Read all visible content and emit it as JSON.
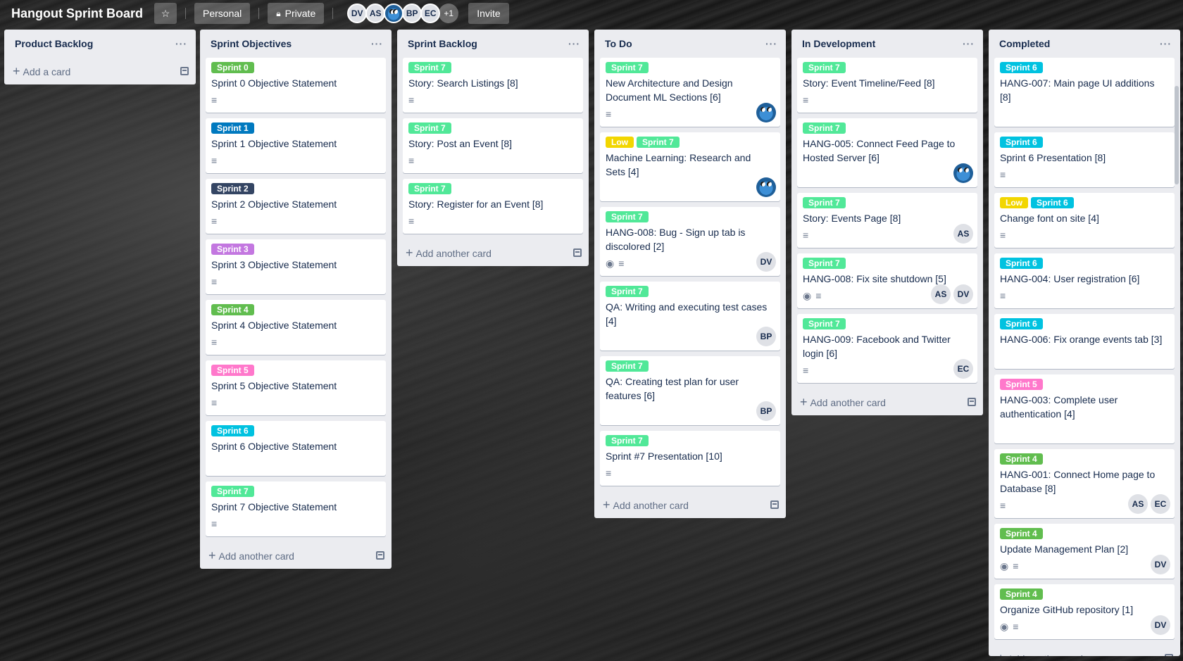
{
  "header": {
    "title": "Hangout Sprint Board",
    "personal_label": "Personal",
    "private_label": "Private",
    "members": [
      "DV",
      "AS",
      "",
      "BP",
      "EC"
    ],
    "more_members": "+1",
    "invite_label": "Invite"
  },
  "label_colors": {
    "Sprint 0": "#61bd4f",
    "Sprint 1": "#0079bf",
    "Sprint 2": "#344563",
    "Sprint 3": "#c377e0",
    "Sprint 4": "#61bd4f",
    "Sprint 5": "#ff78cb",
    "Sprint 6": "#00c2e0",
    "Sprint 7": "#51e898",
    "Low": "#f2d600"
  },
  "lists": [
    {
      "title": "Product Backlog",
      "cards": [],
      "add_label": "Add a card"
    },
    {
      "title": "Sprint Objectives",
      "add_label": "Add another card",
      "cards": [
        {
          "labels": [
            "Sprint 0"
          ],
          "title": "Sprint 0 Objective Statement",
          "desc": true
        },
        {
          "labels": [
            "Sprint 1"
          ],
          "title": "Sprint 1 Objective Statement",
          "desc": true
        },
        {
          "labels": [
            "Sprint 2"
          ],
          "title": "Sprint 2 Objective Statement",
          "desc": true
        },
        {
          "labels": [
            "Sprint 3"
          ],
          "title": "Sprint 3 Objective Statement",
          "desc": true
        },
        {
          "labels": [
            "Sprint 4"
          ],
          "title": "Sprint 4 Objective Statement",
          "desc": true
        },
        {
          "labels": [
            "Sprint 5"
          ],
          "title": "Sprint 5 Objective Statement",
          "desc": true
        },
        {
          "labels": [
            "Sprint 6"
          ],
          "title": "Sprint 6 Objective Statement",
          "desc": false
        },
        {
          "labels": [
            "Sprint 7"
          ],
          "title": "Sprint 7 Objective Statement",
          "desc": true
        }
      ]
    },
    {
      "title": "Sprint Backlog",
      "add_label": "Add another card",
      "cards": [
        {
          "labels": [
            "Sprint 7"
          ],
          "title": "Story: Search Listings [8]",
          "desc": true
        },
        {
          "labels": [
            "Sprint 7"
          ],
          "title": "Story: Post an Event [8]",
          "desc": true
        },
        {
          "labels": [
            "Sprint 7"
          ],
          "title": "Story: Register for an Event [8]",
          "desc": true
        }
      ]
    },
    {
      "title": "To Do",
      "add_label": "Add another card",
      "cards": [
        {
          "labels": [
            "Sprint 7"
          ],
          "title": "New Architecture and Design Document ML Sections [6]",
          "desc": true,
          "members": [
            ""
          ]
        },
        {
          "labels": [
            "Low",
            "Sprint 7"
          ],
          "title": "Machine Learning: Research and Sets [4]",
          "desc": false,
          "members": [
            ""
          ]
        },
        {
          "labels": [
            "Sprint 7"
          ],
          "title": "HANG-008: Bug - Sign up tab is discolored [2]",
          "watch": true,
          "desc": true,
          "members": [
            "DV"
          ]
        },
        {
          "labels": [
            "Sprint 7"
          ],
          "title": "QA: Writing and executing test cases [4]",
          "desc": false,
          "members": [
            "BP"
          ]
        },
        {
          "labels": [
            "Sprint 7"
          ],
          "title": "QA: Creating test plan for user features [6]",
          "desc": false,
          "members": [
            "BP"
          ]
        },
        {
          "labels": [
            "Sprint 7"
          ],
          "title": "Sprint #7 Presentation [10]",
          "desc": true
        }
      ]
    },
    {
      "title": "In Development",
      "add_label": "Add another card",
      "cards": [
        {
          "labels": [
            "Sprint 7"
          ],
          "title": "Story: Event Timeline/Feed [8]",
          "desc": true
        },
        {
          "labels": [
            "Sprint 7"
          ],
          "title": "HANG-005: Connect Feed Page to Hosted Server [6]",
          "desc": false,
          "members": [
            ""
          ]
        },
        {
          "labels": [
            "Sprint 7"
          ],
          "title": "Story: Events Page [8]",
          "desc": true,
          "members": [
            "AS"
          ]
        },
        {
          "labels": [
            "Sprint 7"
          ],
          "title": "HANG-008: Fix site shutdown [5]",
          "watch": true,
          "desc": true,
          "members": [
            "AS",
            "DV"
          ]
        },
        {
          "labels": [
            "Sprint 7"
          ],
          "title": "HANG-009: Facebook and Twitter login [6]",
          "desc": true,
          "members": [
            "EC"
          ]
        }
      ]
    },
    {
      "title": "Completed",
      "add_label": "Add another card",
      "cards": [
        {
          "labels": [
            "Sprint 6"
          ],
          "title": "HANG-007: Main page UI additions [8]",
          "desc": false
        },
        {
          "labels": [
            "Sprint 6"
          ],
          "title": "Sprint 6 Presentation [8]",
          "desc": true
        },
        {
          "labels": [
            "Low",
            "Sprint 6"
          ],
          "title": "Change font on site [4]",
          "desc": true
        },
        {
          "labels": [
            "Sprint 6"
          ],
          "title": "HANG-004: User registration [6]",
          "desc": true
        },
        {
          "labels": [
            "Sprint 6"
          ],
          "title": "HANG-006: Fix orange events tab [3]",
          "desc": false
        },
        {
          "labels": [
            "Sprint 5"
          ],
          "title": "HANG-003: Complete user authentication [4]",
          "desc": false
        },
        {
          "labels": [
            "Sprint 4"
          ],
          "title": "HANG-001: Connect Home page to Database [8]",
          "desc": true,
          "members": [
            "AS",
            "EC"
          ]
        },
        {
          "labels": [
            "Sprint 4"
          ],
          "title": "Update Management Plan [2]",
          "watch": true,
          "desc": true,
          "members": [
            "DV"
          ]
        },
        {
          "labels": [
            "Sprint 4"
          ],
          "title": "Organize GitHub repository [1]",
          "watch": true,
          "desc": true,
          "members": [
            "DV"
          ]
        }
      ]
    }
  ]
}
